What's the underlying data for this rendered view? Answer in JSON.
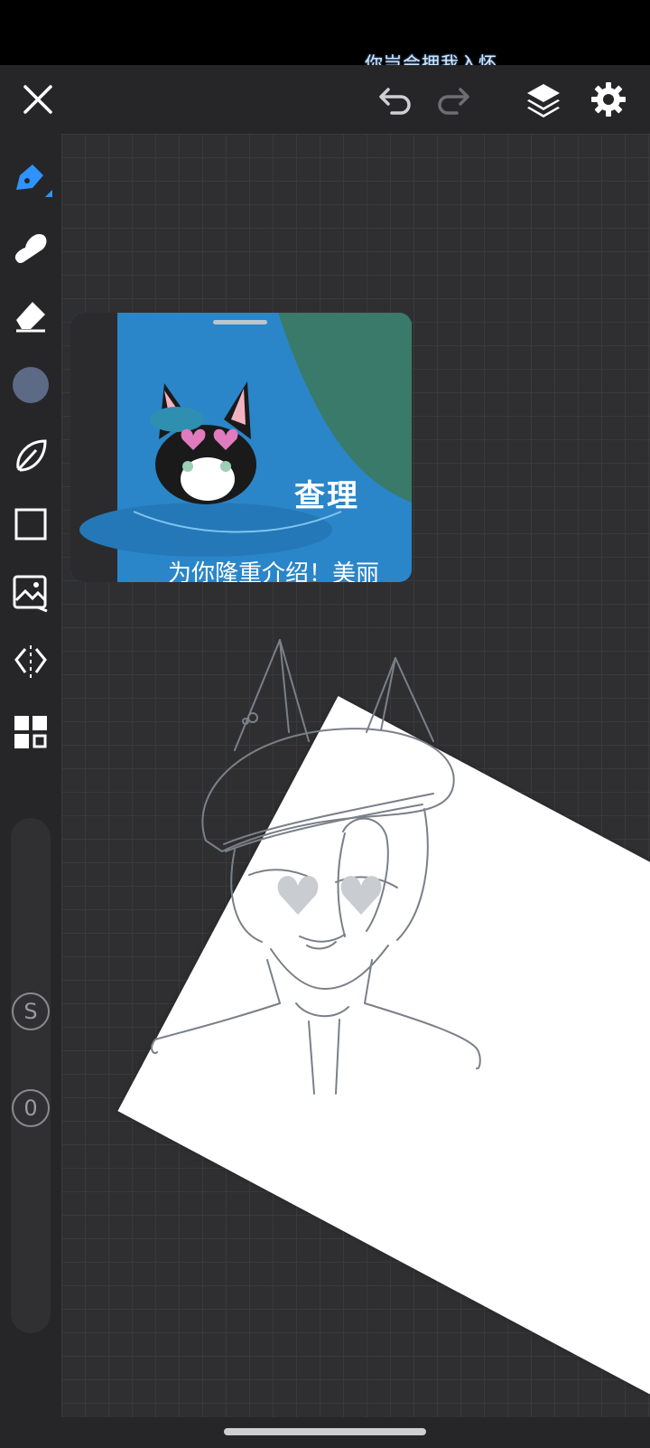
{
  "status_bar": {
    "lyric": "你岂会拥我入怀"
  },
  "toolbar": {
    "icons": {
      "close": "close-icon",
      "undo": "undo-icon",
      "redo": "redo-icon",
      "layers": "layers-icon",
      "settings": "gear-icon"
    }
  },
  "tools": [
    {
      "name": "pen-tool",
      "icon": "pen-icon"
    },
    {
      "name": "smudge-tool",
      "icon": "finger-smudge-icon"
    },
    {
      "name": "eraser-tool",
      "icon": "eraser-icon"
    },
    {
      "name": "color-swatch",
      "icon": "color-circle"
    },
    {
      "name": "lasso-tool",
      "icon": "leaf-lasso-icon"
    },
    {
      "name": "shape-tool",
      "icon": "square-icon"
    },
    {
      "name": "image-tool",
      "icon": "image-icon"
    },
    {
      "name": "symmetry-tool",
      "icon": "symmetry-icon"
    },
    {
      "name": "more-tools",
      "icon": "grid-icon"
    }
  ],
  "slider": {
    "size_label": "S",
    "opacity_label": "0"
  },
  "reference": {
    "title": "查理",
    "subtitle": "为你隆重介绍！美丽"
  },
  "colors": {
    "accent": "#2f93ff",
    "swatch": "#5c6a85",
    "background": "#2b2b2d",
    "panel": "#262628"
  }
}
